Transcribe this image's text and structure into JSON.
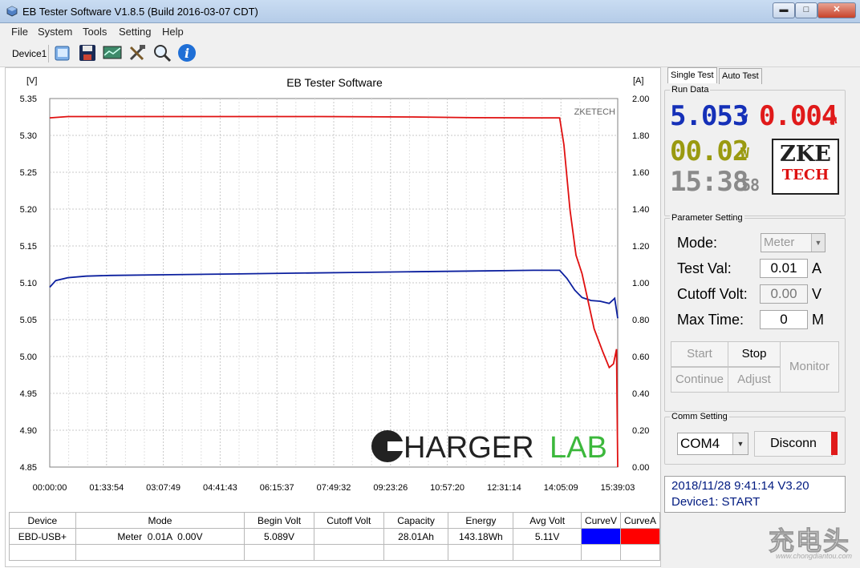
{
  "window": {
    "title": "EB Tester Software V1.8.5 (Build 2016-03-07 CDT)",
    "controls": {
      "minimize": "▬",
      "maximize": "□",
      "close": "✕"
    }
  },
  "menu": [
    "File",
    "System",
    "Tools",
    "Setting",
    "Help"
  ],
  "toolbar": {
    "device_label": "Device1",
    "icons": [
      "open-folder-icon",
      "save-disk-icon",
      "monitor-screen-icon",
      "tools-icon",
      "zoom-magnifier-icon",
      "info-icon"
    ]
  },
  "chart_data": {
    "type": "line",
    "title": "EB Tester Software",
    "ylabel_left": "[V]",
    "ylabel_right": "[A]",
    "annotation": "ZKETECH",
    "ylim_left": [
      4.85,
      5.35
    ],
    "ylim_right": [
      0.0,
      2.0
    ],
    "yticks_left": [
      "5.35",
      "5.30",
      "5.25",
      "5.20",
      "5.15",
      "5.10",
      "5.05",
      "5.00",
      "4.95",
      "4.90",
      "4.85"
    ],
    "yticks_right": [
      "2.00",
      "1.80",
      "1.60",
      "1.40",
      "1.20",
      "1.00",
      "0.80",
      "0.60",
      "0.40",
      "0.20",
      "0.00"
    ],
    "xticks": [
      "00:00:00",
      "01:33:54",
      "03:07:49",
      "04:41:43",
      "06:15:37",
      "07:49:32",
      "09:23:26",
      "10:57:20",
      "12:31:14",
      "14:05:09",
      "15:39:03"
    ],
    "x_minutes": [
      0,
      93.9,
      187.8,
      281.7,
      375.6,
      469.5,
      563.4,
      657.3,
      751.2,
      845.1,
      939
    ],
    "grid": true,
    "series": [
      {
        "axis": "left",
        "color": "#0b1f9e",
        "points": [
          [
            0,
            5.094
          ],
          [
            10,
            5.103
          ],
          [
            30,
            5.107
          ],
          [
            60,
            5.109
          ],
          [
            100,
            5.11
          ],
          [
            200,
            5.111
          ],
          [
            300,
            5.112
          ],
          [
            400,
            5.113
          ],
          [
            500,
            5.114
          ],
          [
            600,
            5.115
          ],
          [
            700,
            5.116
          ],
          [
            800,
            5.117
          ],
          [
            843,
            5.117
          ],
          [
            855,
            5.106
          ],
          [
            868,
            5.09
          ],
          [
            880,
            5.08
          ],
          [
            895,
            5.076
          ],
          [
            910,
            5.075
          ],
          [
            925,
            5.072
          ],
          [
            934,
            5.079
          ],
          [
            939,
            5.052
          ]
        ]
      },
      {
        "axis": "right",
        "color": "#e01010",
        "points": [
          [
            0,
            1.895
          ],
          [
            30,
            1.902
          ],
          [
            150,
            1.902
          ],
          [
            300,
            1.902
          ],
          [
            450,
            1.902
          ],
          [
            600,
            1.9
          ],
          [
            700,
            1.896
          ],
          [
            800,
            1.895
          ],
          [
            843,
            1.895
          ],
          [
            850,
            1.75
          ],
          [
            860,
            1.4
          ],
          [
            870,
            1.15
          ],
          [
            880,
            1.05
          ],
          [
            890,
            0.9
          ],
          [
            900,
            0.75
          ],
          [
            915,
            0.62
          ],
          [
            925,
            0.54
          ],
          [
            932,
            0.56
          ],
          [
            937,
            0.64
          ],
          [
            939,
            0.0
          ]
        ]
      }
    ]
  },
  "results_table": {
    "headers": [
      "Device",
      "Mode",
      "Begin Volt",
      "Cutoff Volt",
      "Capacity",
      "Energy",
      "Avg Volt",
      "CurveV",
      "CurveA"
    ],
    "row": [
      "EBD-USB+",
      "Meter  0.01A  0.00V",
      "5.089V",
      "",
      "28.01Ah",
      "143.18Wh",
      "5.11V",
      "",
      ""
    ],
    "curve_colors": [
      "#0000ff",
      "#ff0000"
    ]
  },
  "right_panel": {
    "tabs": [
      "Single Test",
      "Auto Test"
    ],
    "run_data": {
      "title": "Run Data",
      "voltage": "5.053",
      "voltage_unit": "V",
      "current": "0.004",
      "current_unit": "A",
      "power": "00.02",
      "power_unit": "W",
      "time": "15:38",
      "time_sec": "58",
      "logo_line1": "ZKE",
      "logo_line2": "TECH"
    },
    "parameter": {
      "title": "Parameter Setting",
      "mode_label": "Mode:",
      "mode_value": "Meter",
      "test_val_label": "Test Val:",
      "test_val": "0.01",
      "test_val_unit": "A",
      "cutoff_label": "Cutoff Volt:",
      "cutoff_val": "0.00",
      "cutoff_unit": "V",
      "maxtime_label": "Max Time:",
      "maxtime_val": "0",
      "maxtime_unit": "M",
      "btn_start": "Start",
      "btn_stop": "Stop",
      "btn_continue": "Continue",
      "btn_adjust": "Adjust",
      "btn_monitor": "Monitor"
    },
    "comm": {
      "title": "Comm Setting",
      "port": "COM4",
      "disconnect": "Disconn"
    },
    "status": {
      "line1": "2018/11/28 9:41:14  V3.20",
      "line2": "Device1: START"
    }
  },
  "overlays": {
    "chargerlab": "HARGER",
    "chargerlab_lab": "LAB",
    "watermark_cn": "充电头",
    "watermark_url": "www.chongdiantou.com"
  },
  "colors": {
    "lcd_blue": "#1530b8",
    "lcd_red": "#e01a1a",
    "lcd_yellow": "#9a9a10",
    "lcd_gray": "#8a8a8a",
    "chargerlab_green": "#3cb83c"
  }
}
